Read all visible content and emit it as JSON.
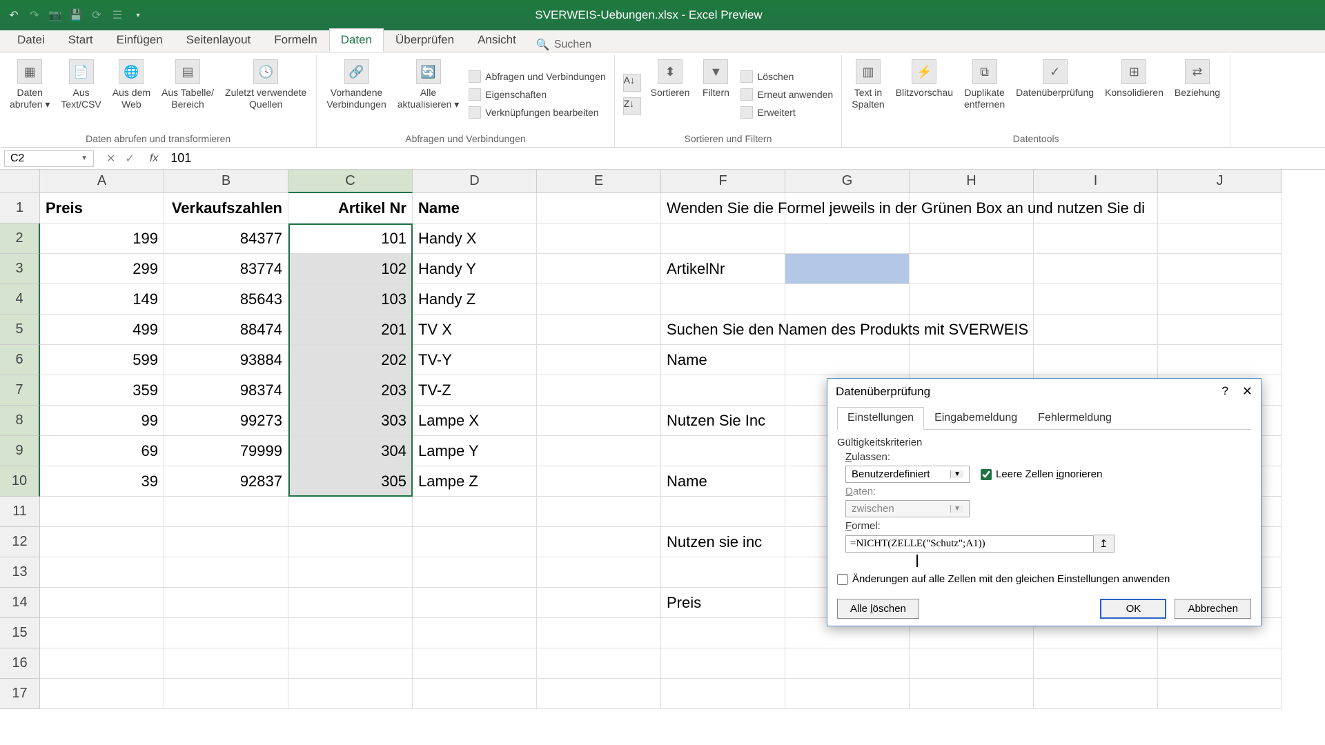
{
  "app": {
    "title": "SVERWEIS-Uebungen.xlsx - Excel Preview"
  },
  "tabs": {
    "items": [
      "Datei",
      "Start",
      "Einfügen",
      "Seitenlayout",
      "Formeln",
      "Daten",
      "Überprüfen",
      "Ansicht"
    ],
    "active": "Daten",
    "search_placeholder": "Suchen"
  },
  "ribbon": {
    "group1": {
      "label": "Daten abrufen und transformieren",
      "btns": [
        {
          "l1": "Daten",
          "l2": "abrufen ▾"
        },
        {
          "l1": "Aus",
          "l2": "Text/CSV"
        },
        {
          "l1": "Aus dem",
          "l2": "Web"
        },
        {
          "l1": "Aus Tabelle/",
          "l2": "Bereich"
        },
        {
          "l1": "Zuletzt verwendete",
          "l2": "Quellen"
        }
      ]
    },
    "group2": {
      "label": "Abfragen und Verbindungen",
      "btns": [
        {
          "l1": "Vorhandene",
          "l2": "Verbindungen"
        },
        {
          "l1": "Alle",
          "l2": "aktualisieren ▾"
        }
      ],
      "small": [
        "Abfragen und Verbindungen",
        "Eigenschaften",
        "Verknüpfungen bearbeiten"
      ]
    },
    "group3": {
      "label": "Sortieren und Filtern",
      "btns": [
        {
          "l1": "Sortieren",
          "l2": ""
        },
        {
          "l1": "Filtern",
          "l2": ""
        }
      ],
      "small": [
        "Löschen",
        "Erneut anwenden",
        "Erweitert"
      ]
    },
    "group4": {
      "label": "Datentools",
      "btns": [
        {
          "l1": "Text in",
          "l2": "Spalten"
        },
        {
          "l1": "Blitzvorschau",
          "l2": ""
        },
        {
          "l1": "Duplikate",
          "l2": "entfernen"
        },
        {
          "l1": "Datenüberprüfung",
          "l2": ""
        },
        {
          "l1": "Konsolidieren",
          "l2": ""
        },
        {
          "l1": "Beziehung",
          "l2": ""
        }
      ]
    }
  },
  "namebox": "C2",
  "formula": "101",
  "columns": [
    "A",
    "B",
    "C",
    "D",
    "E",
    "F",
    "G",
    "H",
    "I",
    "J"
  ],
  "sheet": {
    "headers": {
      "A": "Preis",
      "B": "Verkaufszahlen",
      "C": "Artikel Nr",
      "D": "Name"
    },
    "rows": [
      {
        "A": "199",
        "B": "84377",
        "C": "101",
        "D": "Handy X"
      },
      {
        "A": "299",
        "B": "83774",
        "C": "102",
        "D": "Handy Y"
      },
      {
        "A": "149",
        "B": "85643",
        "C": "103",
        "D": "Handy Z"
      },
      {
        "A": "499",
        "B": "88474",
        "C": "201",
        "D": "TV X"
      },
      {
        "A": "599",
        "B": "93884",
        "C": "202",
        "D": "TV-Y"
      },
      {
        "A": "359",
        "B": "98374",
        "C": "203",
        "D": "TV-Z"
      },
      {
        "A": "99",
        "B": "99273",
        "C": "303",
        "D": "Lampe X"
      },
      {
        "A": "69",
        "B": "79999",
        "C": "304",
        "D": "Lampe Y"
      },
      {
        "A": "39",
        "B": "92837",
        "C": "305",
        "D": "Lampe Z"
      }
    ],
    "instructions": {
      "r1": "Wenden Sie die Formel jeweils in der Grünen Box an und nutzen Sie di",
      "r3": "ArtikelNr",
      "r5": "Suchen Sie den Namen des Produkts mit SVERWEIS",
      "r6": "Name",
      "r8": "Nutzen Sie Inc",
      "r10": "Name",
      "r12": "Nutzen sie inc",
      "r14": "Preis"
    }
  },
  "dialog": {
    "title": "Datenüberprüfung",
    "tabs": [
      "Einstellungen",
      "Eingabemeldung",
      "Fehlermeldung"
    ],
    "section": "Gültigkeitskriterien",
    "allow_label": "Zulassen:",
    "allow_value": "Benutzerdefiniert",
    "ignore_blank": "Leere Zellen ignorieren",
    "data_label": "Daten:",
    "data_value": "zwischen",
    "formula_label": "Formel:",
    "formula_value": "=NICHT(ZELLE(\"Schutz\";A1))",
    "apply_changes": "Änderungen auf alle Zellen mit den gleichen Einstellungen anwenden",
    "clear_all": "Alle löschen",
    "ok": "OK",
    "cancel": "Abbrechen"
  }
}
